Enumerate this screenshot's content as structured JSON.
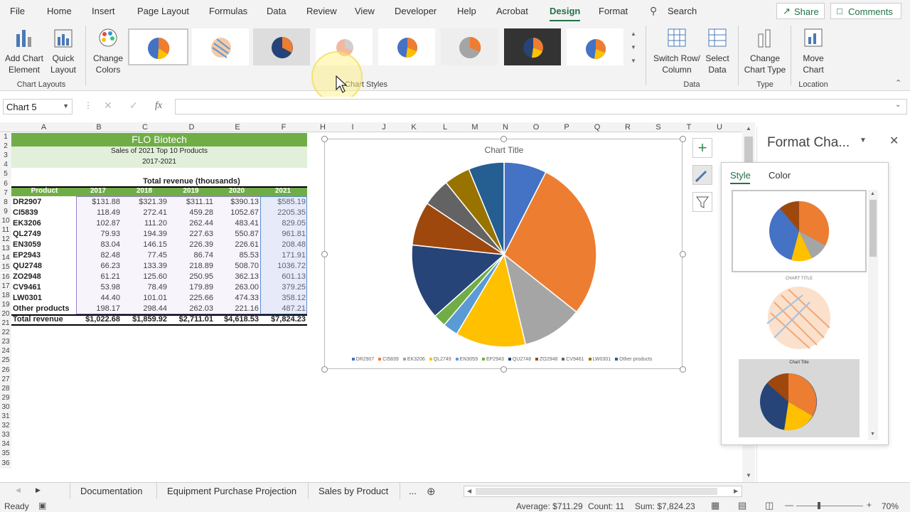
{
  "menu": {
    "tabs": [
      "File",
      "Home",
      "Insert",
      "Page Layout",
      "Formulas",
      "Data",
      "Review",
      "View",
      "Developer",
      "Help",
      "Acrobat",
      "Design",
      "Format"
    ],
    "active": "Design",
    "search": "Search",
    "share": "Share",
    "comments": "Comments"
  },
  "ribbon": {
    "add_chart_element": "Add Chart Element",
    "quick_layout": "Quick Layout",
    "change_colors": "Change Colors",
    "chart_layouts_group": "Chart Layouts",
    "chart_styles_group": "Chart Styles",
    "switch_row_column": "Switch Row/ Column",
    "select_data": "Select Data",
    "data_group": "Data",
    "change_chart_type": "Change Chart Type",
    "type_group": "Type",
    "move_chart": "Move Chart",
    "location_group": "Location"
  },
  "formula_bar": {
    "name_box": "Chart 5",
    "fx": "fx",
    "formula": ""
  },
  "columns": [
    "A",
    "B",
    "C",
    "D",
    "E",
    "F",
    "H",
    "I",
    "J",
    "K",
    "L",
    "M",
    "N",
    "O",
    "P",
    "Q",
    "R",
    "S",
    "T",
    "U"
  ],
  "rows": [
    "1",
    "2",
    "3",
    "4",
    "5",
    "6",
    "7",
    "8",
    "9",
    "10",
    "11",
    "12",
    "13",
    "14",
    "15",
    "16",
    "17",
    "18",
    "19",
    "20",
    "21",
    "22",
    "23",
    "24",
    "25",
    "26",
    "27",
    "28",
    "29",
    "30",
    "31",
    "32",
    "33",
    "34",
    "35",
    "36"
  ],
  "sheet": {
    "title": "FLO Biotech",
    "subtitle": "Sales of 2021 Top 10 Products",
    "years": "2017-2021",
    "total_label": "Total revenue (thousands)",
    "headers": [
      "Product",
      "2017",
      "2018",
      "2019",
      "2020",
      "2021"
    ],
    "data": [
      [
        "DR2907",
        "$131.88",
        "$321.39",
        "$311.11",
        "$390.13",
        "$585.19"
      ],
      [
        "CI5839",
        "118.49",
        "272.41",
        "459.28",
        "1052.67",
        "2205.35"
      ],
      [
        "EK3206",
        "102.87",
        "111.20",
        "262.44",
        "483.41",
        "829.05"
      ],
      [
        "QL2749",
        "79.93",
        "194.39",
        "227.63",
        "550.87",
        "961.81"
      ],
      [
        "EN3059",
        "83.04",
        "146.15",
        "226.39",
        "226.61",
        "208.48"
      ],
      [
        "EP2943",
        "82.48",
        "77.45",
        "86.74",
        "85.53",
        "171.91"
      ],
      [
        "QU2748",
        "66.23",
        "133.39",
        "218.89",
        "508.70",
        "1036.72"
      ],
      [
        "ZO2948",
        "61.21",
        "125.60",
        "250.95",
        "362.13",
        "601.13"
      ],
      [
        "CV9461",
        "53.98",
        "78.49",
        "179.89",
        "263.00",
        "379.25"
      ],
      [
        "LW0301",
        "44.40",
        "101.01",
        "225.66",
        "474.33",
        "358.12"
      ],
      [
        "Other products",
        "198.17",
        "298.44",
        "262.03",
        "221.16",
        "487.21"
      ]
    ],
    "total_row": [
      "Total revenue",
      "$1,022.68",
      "$1,859.92",
      "$2,711.01",
      "$4,618.53",
      "$7,824.23"
    ]
  },
  "chart_data": {
    "type": "pie",
    "title": "Chart Title",
    "categories": [
      "DR2907",
      "CI5839",
      "EK3206",
      "QL2749",
      "EN3059",
      "EP2943",
      "QU2748",
      "ZO2948",
      "CV9461",
      "LW0301",
      "Other products"
    ],
    "values": [
      585.19,
      2205.35,
      829.05,
      961.81,
      208.48,
      171.91,
      1036.72,
      601.13,
      379.25,
      358.12,
      487.21
    ],
    "colors": [
      "#4472c4",
      "#ed7d31",
      "#a5a5a5",
      "#ffc000",
      "#5b9bd5",
      "#70ad47",
      "#264478",
      "#9e480e",
      "#636363",
      "#997300",
      "#255e91"
    ],
    "legend": "bottom"
  },
  "pane": {
    "title": "Format Cha...",
    "tab_style": "Style",
    "tab_color": "Color",
    "style2_title": "CHART TITLE",
    "style3_title": "Chart Title"
  },
  "tabs": {
    "documentation": "Documentation",
    "equipment": "Equipment Purchase Projection",
    "sales": "Sales by Product",
    "more": "..."
  },
  "status": {
    "ready": "Ready",
    "average": "Average: $711.29",
    "count": "Count: 11",
    "sum": "Sum: $7,824.23",
    "zoom": "70%"
  }
}
